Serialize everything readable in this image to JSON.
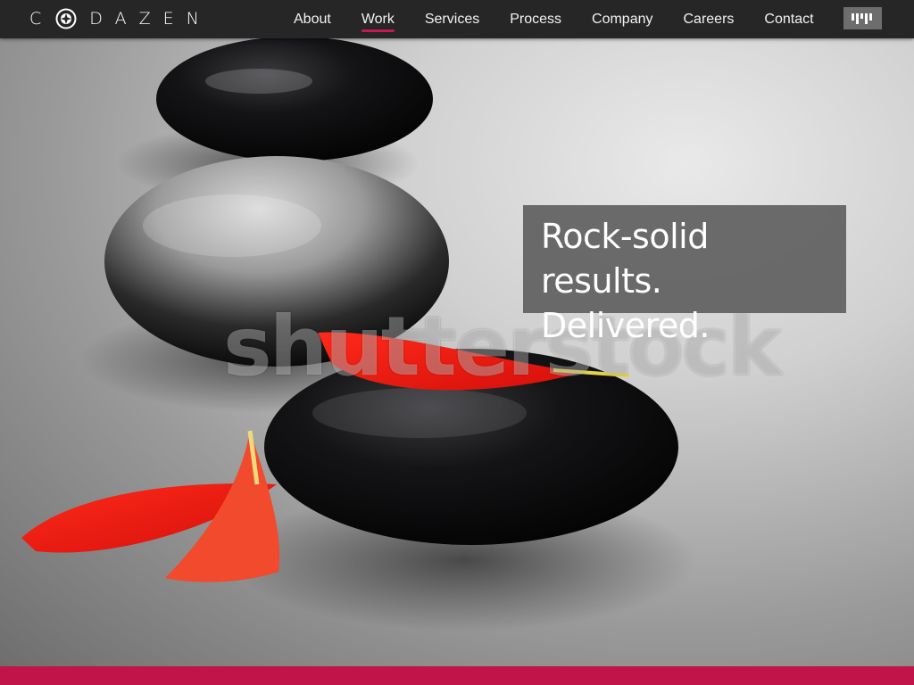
{
  "brand": {
    "name": "DAZEN",
    "initial": "C",
    "logo_icon": "compass-logo-icon"
  },
  "nav": {
    "items": [
      {
        "label": "About",
        "active": false
      },
      {
        "label": "Work",
        "active": true
      },
      {
        "label": "Services",
        "active": false
      },
      {
        "label": "Process",
        "active": false
      },
      {
        "label": "Company",
        "active": false
      },
      {
        "label": "Careers",
        "active": false
      },
      {
        "label": "Contact",
        "active": false
      }
    ],
    "menu_icon": "bars-menu-icon"
  },
  "hero": {
    "tagline_line1": "Rock-solid results.",
    "tagline_line2": "Delivered.",
    "watermark": "shutterstock",
    "image_subject": "black stones with red petals"
  },
  "colors": {
    "accent": "#c8174f",
    "navbar": "#262626",
    "tagline_bg": "#606060",
    "footer": "#c1154a"
  }
}
